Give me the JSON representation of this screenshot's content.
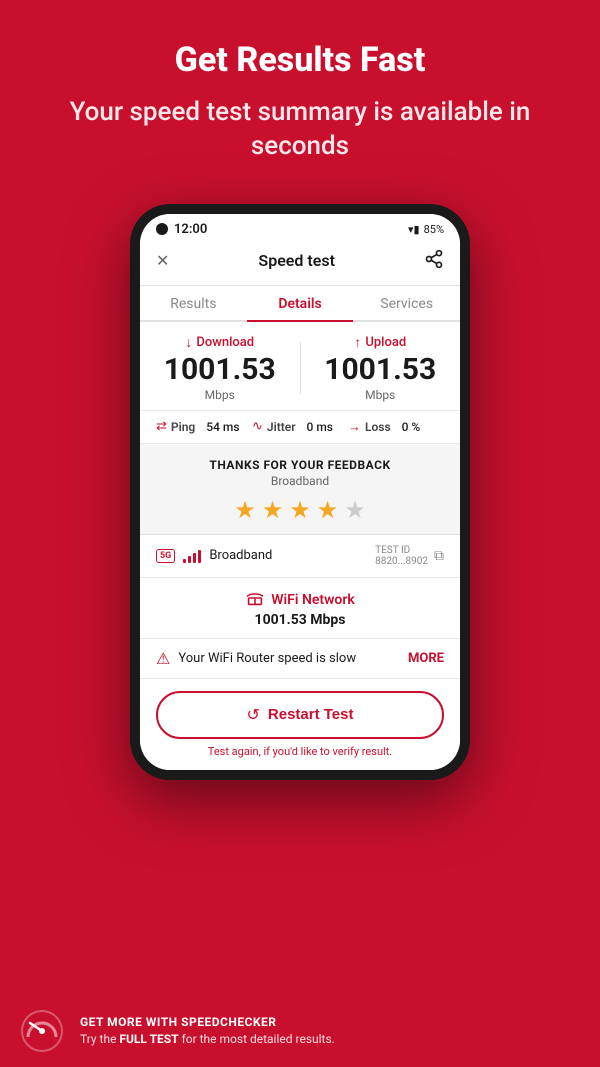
{
  "header": {
    "title": "Get Results Fast",
    "subtitle": "Your speed test summary is available in seconds"
  },
  "status_bar": {
    "time": "12:00",
    "battery": "85%"
  },
  "app_header": {
    "title": "Speed test"
  },
  "tabs": {
    "items": [
      {
        "label": "Results",
        "active": false
      },
      {
        "label": "Details",
        "active": true
      },
      {
        "label": "Services",
        "active": false
      }
    ]
  },
  "speed": {
    "download_label": "Download",
    "download_value": "1001.53",
    "download_unit": "Mbps",
    "upload_label": "Upload",
    "upload_value": "1001.53",
    "upload_unit": "Mbps"
  },
  "ping": {
    "ping_label": "Ping",
    "ping_value": "54 ms",
    "jitter_label": "Jitter",
    "jitter_value": "0 ms",
    "loss_label": "Loss",
    "loss_value": "0 %"
  },
  "feedback": {
    "title": "THANKS FOR YOUR FEEDBACK",
    "subtitle": "Broadband",
    "stars": [
      true,
      true,
      true,
      true,
      false
    ]
  },
  "network": {
    "badge": "5G",
    "name": "Broadband",
    "test_id_label": "TEST ID",
    "test_id_value": "8820...8902"
  },
  "wifi": {
    "label": "WiFi Network",
    "speed": "1001.53 Mbps"
  },
  "warning": {
    "text": "Your WiFi Router speed is slow",
    "more_label": "MORE"
  },
  "restart_btn": {
    "label": "Restart Test",
    "hint": "Test again, if you'd like to verify result."
  },
  "bottom_banner": {
    "title": "GET MORE WITH SPEEDCHECKER",
    "description_prefix": "Try the ",
    "description_bold": "FULL TEST",
    "description_suffix": " for the most detailed results."
  }
}
